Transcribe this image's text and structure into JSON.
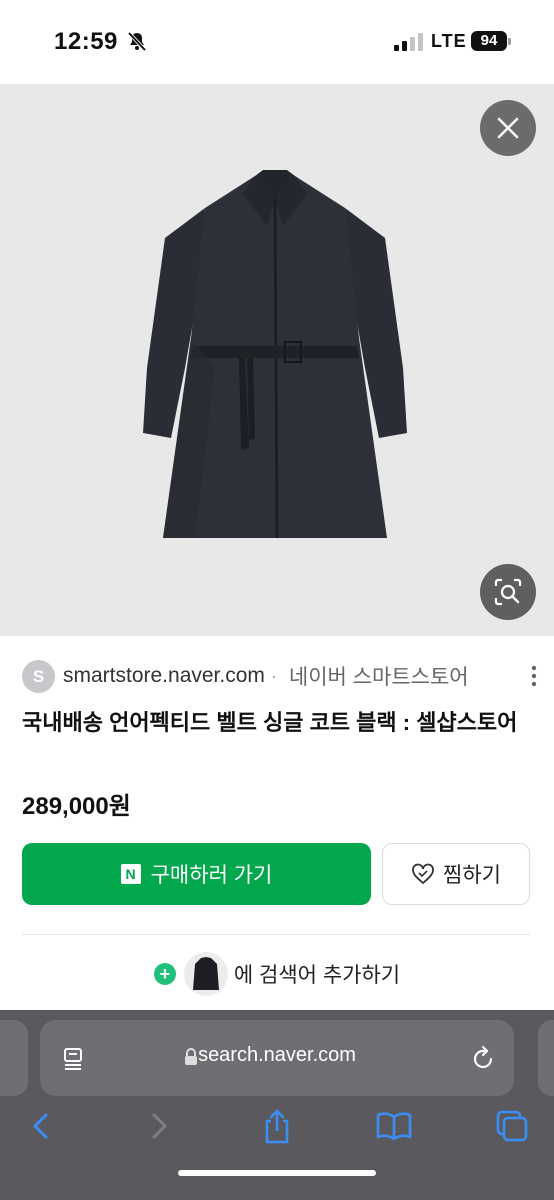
{
  "status": {
    "time": "12:59",
    "network": "LTE",
    "battery": "94"
  },
  "image_viewer": {
    "close_icon": "close-icon",
    "lens_icon": "visual-search-icon"
  },
  "source": {
    "avatar_letter": "S",
    "domain": "smartstore.naver.com",
    "separator": "·",
    "name": "네이버 스마트스토어"
  },
  "product": {
    "title": "국내배송 언어펙티드 벨트 싱글 코트 블랙 : 셀샵스토어",
    "price": "289,000원"
  },
  "actions": {
    "buy_label": "구매하러 가기",
    "buy_badge": "N",
    "wish_label": "찜하기",
    "add_plus": "+",
    "add_search_text": "에 검색어 추가하기"
  },
  "browser": {
    "url": "search.naver.com"
  },
  "colors": {
    "buy_green": "#03a84d",
    "plus_green": "#20c07a",
    "ios_blue": "#3a8ef6"
  }
}
